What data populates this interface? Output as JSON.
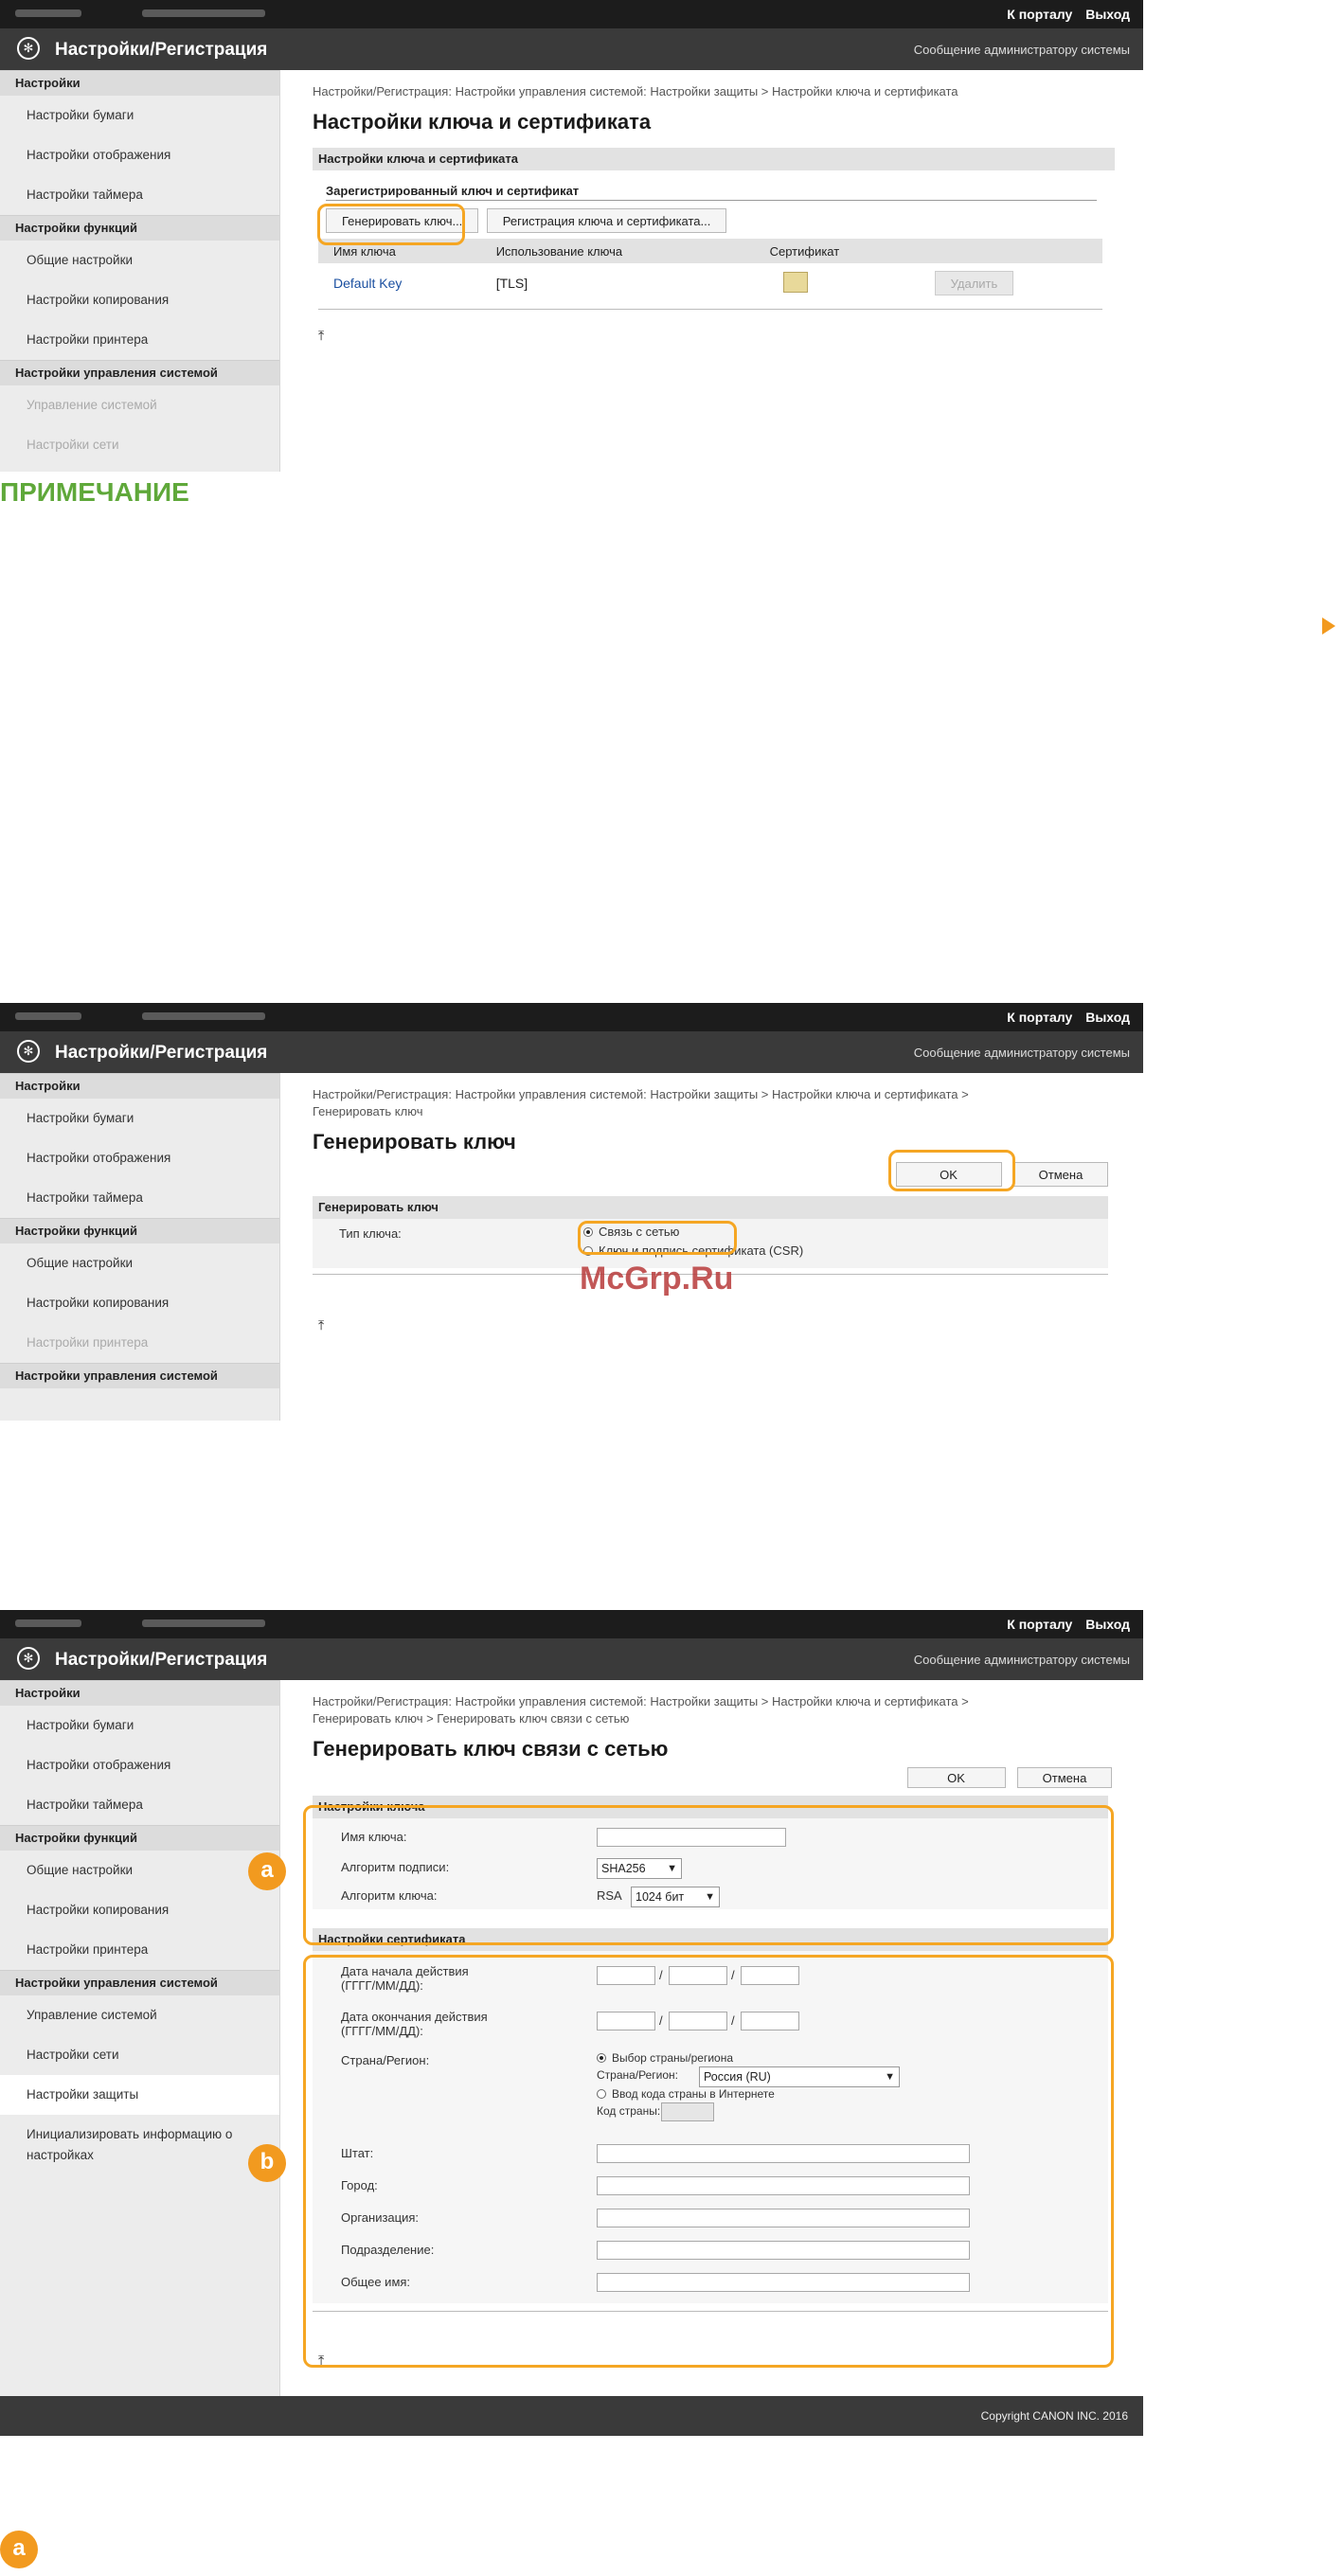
{
  "common": {
    "toplinks": [
      "К порталу",
      "Выход"
    ],
    "app_title": "Настройки/Регистрация",
    "admin_message": "Сообщение администратору системы"
  },
  "note": {
    "title": "ПРИМЕЧАНИЕ"
  },
  "watermark": "McGrp.Ru",
  "shot1": {
    "sidebar": [
      {
        "type": "head",
        "label": "Настройки"
      },
      {
        "type": "item",
        "label": "Настройки бумаги"
      },
      {
        "type": "item",
        "label": "Настройки отображения"
      },
      {
        "type": "item",
        "label": "Настройки таймера"
      },
      {
        "type": "head",
        "label": "Настройки функций"
      },
      {
        "type": "item",
        "label": "Общие настройки"
      },
      {
        "type": "item",
        "label": "Настройки копирования"
      },
      {
        "type": "item",
        "label": "Настройки принтера"
      },
      {
        "type": "head",
        "label": "Настройки управления системой"
      },
      {
        "type": "item",
        "label": "Управление системой",
        "dim": true
      },
      {
        "type": "item",
        "label": "Настройки сети",
        "dim": true
      }
    ],
    "breadcrumb": "Настройки/Регистрация: Настройки управления системой: Настройки защиты > Настройки ключа и сертификата",
    "title": "Настройки ключа и сертификата",
    "section": "Настройки ключа и сертификата",
    "subsection": "Зарегистрированный ключ и сертификат",
    "btn_generate": "Генерировать ключ...",
    "btn_register": "Регистрация ключа и сертификата...",
    "table": {
      "headers": [
        "Имя ключа",
        "Использование ключа",
        "Сертификат",
        ""
      ],
      "rows": [
        {
          "name": "Default Key",
          "usage": "[TLS]",
          "delete": "Удалить"
        }
      ]
    }
  },
  "shot2": {
    "sidebar": [
      {
        "type": "head",
        "label": "Настройки"
      },
      {
        "type": "item",
        "label": "Настройки бумаги"
      },
      {
        "type": "item",
        "label": "Настройки отображения"
      },
      {
        "type": "item",
        "label": "Настройки таймера"
      },
      {
        "type": "head",
        "label": "Настройки функций"
      },
      {
        "type": "item",
        "label": "Общие настройки"
      },
      {
        "type": "item",
        "label": "Настройки копирования"
      },
      {
        "type": "item",
        "label": "Настройки принтера",
        "dim": true
      },
      {
        "type": "head",
        "label": "Настройки управления системой",
        "dim": true
      }
    ],
    "breadcrumb_1": "Настройки/Регистрация: Настройки управления системой: Настройки защиты > Настройки ключа и сертификата >",
    "breadcrumb_2": "Генерировать ключ",
    "title": "Генерировать ключ",
    "ok": "OK",
    "cancel": "Отмена",
    "section": "Генерировать ключ",
    "key_type_label": "Тип ключа:",
    "option_network": "Связь с сетью",
    "option_csr": "Ключ и подпись сертификата (CSR)"
  },
  "shot3": {
    "sidebar": [
      {
        "type": "head",
        "label": "Настройки"
      },
      {
        "type": "item",
        "label": "Настройки бумаги"
      },
      {
        "type": "item",
        "label": "Настройки отображения"
      },
      {
        "type": "item",
        "label": "Настройки таймера"
      },
      {
        "type": "head",
        "label": "Настройки функций"
      },
      {
        "type": "item",
        "label": "Общие настройки"
      },
      {
        "type": "item",
        "label": "Настройки копирования"
      },
      {
        "type": "item",
        "label": "Настройки принтера"
      },
      {
        "type": "head",
        "label": "Настройки управления системой"
      },
      {
        "type": "item",
        "label": "Управление системой"
      },
      {
        "type": "item",
        "label": "Настройки сети"
      },
      {
        "type": "item",
        "label": "Настройки защиты",
        "active": true
      },
      {
        "type": "item2",
        "label": "Инициализировать информацию о настройках"
      }
    ],
    "breadcrumb_1": "Настройки/Регистрация: Настройки управления системой: Настройки защиты > Настройки ключа и сертификата >",
    "breadcrumb_2": "Генерировать ключ > Генерировать ключ связи с сетью",
    "title": "Генерировать ключ связи с сетью",
    "ok": "OK",
    "cancel": "Отмена",
    "key_settings": {
      "section": "Настройки ключа",
      "key_name": "Имя ключа:",
      "sig_algo": "Алгоритм подписи:",
      "sig_algo_value": "SHA256",
      "key_algo": "Алгоритм ключа:",
      "key_algo_prefix": "RSA",
      "key_algo_value": "1024 бит"
    },
    "cert_settings": {
      "section": "Настройки сертификата",
      "start_date_1": "Дата начала действия",
      "start_date_2": "(ГГГГ/ММ/ДД):",
      "end_date_1": "Дата окончания действия",
      "end_date_2": "(ГГГГ/ММ/ДД):",
      "country": "Страна/Регион:",
      "opt_select": "Выбор страны/региона",
      "country_sub": "Страна/Регион:",
      "country_value": "Россия (RU)",
      "opt_internet": "Ввод кода страны в Интернете",
      "code_label": "Код страны:",
      "state": "Штат:",
      "city": "Город:",
      "org": "Организация:",
      "dept": "Подразделение:",
      "common_name": "Общее имя:",
      "slash": "/"
    },
    "copyright": "Copyright CANON INC. 2016",
    "badges": [
      "a",
      "b"
    ]
  },
  "bottom_badge": "a"
}
